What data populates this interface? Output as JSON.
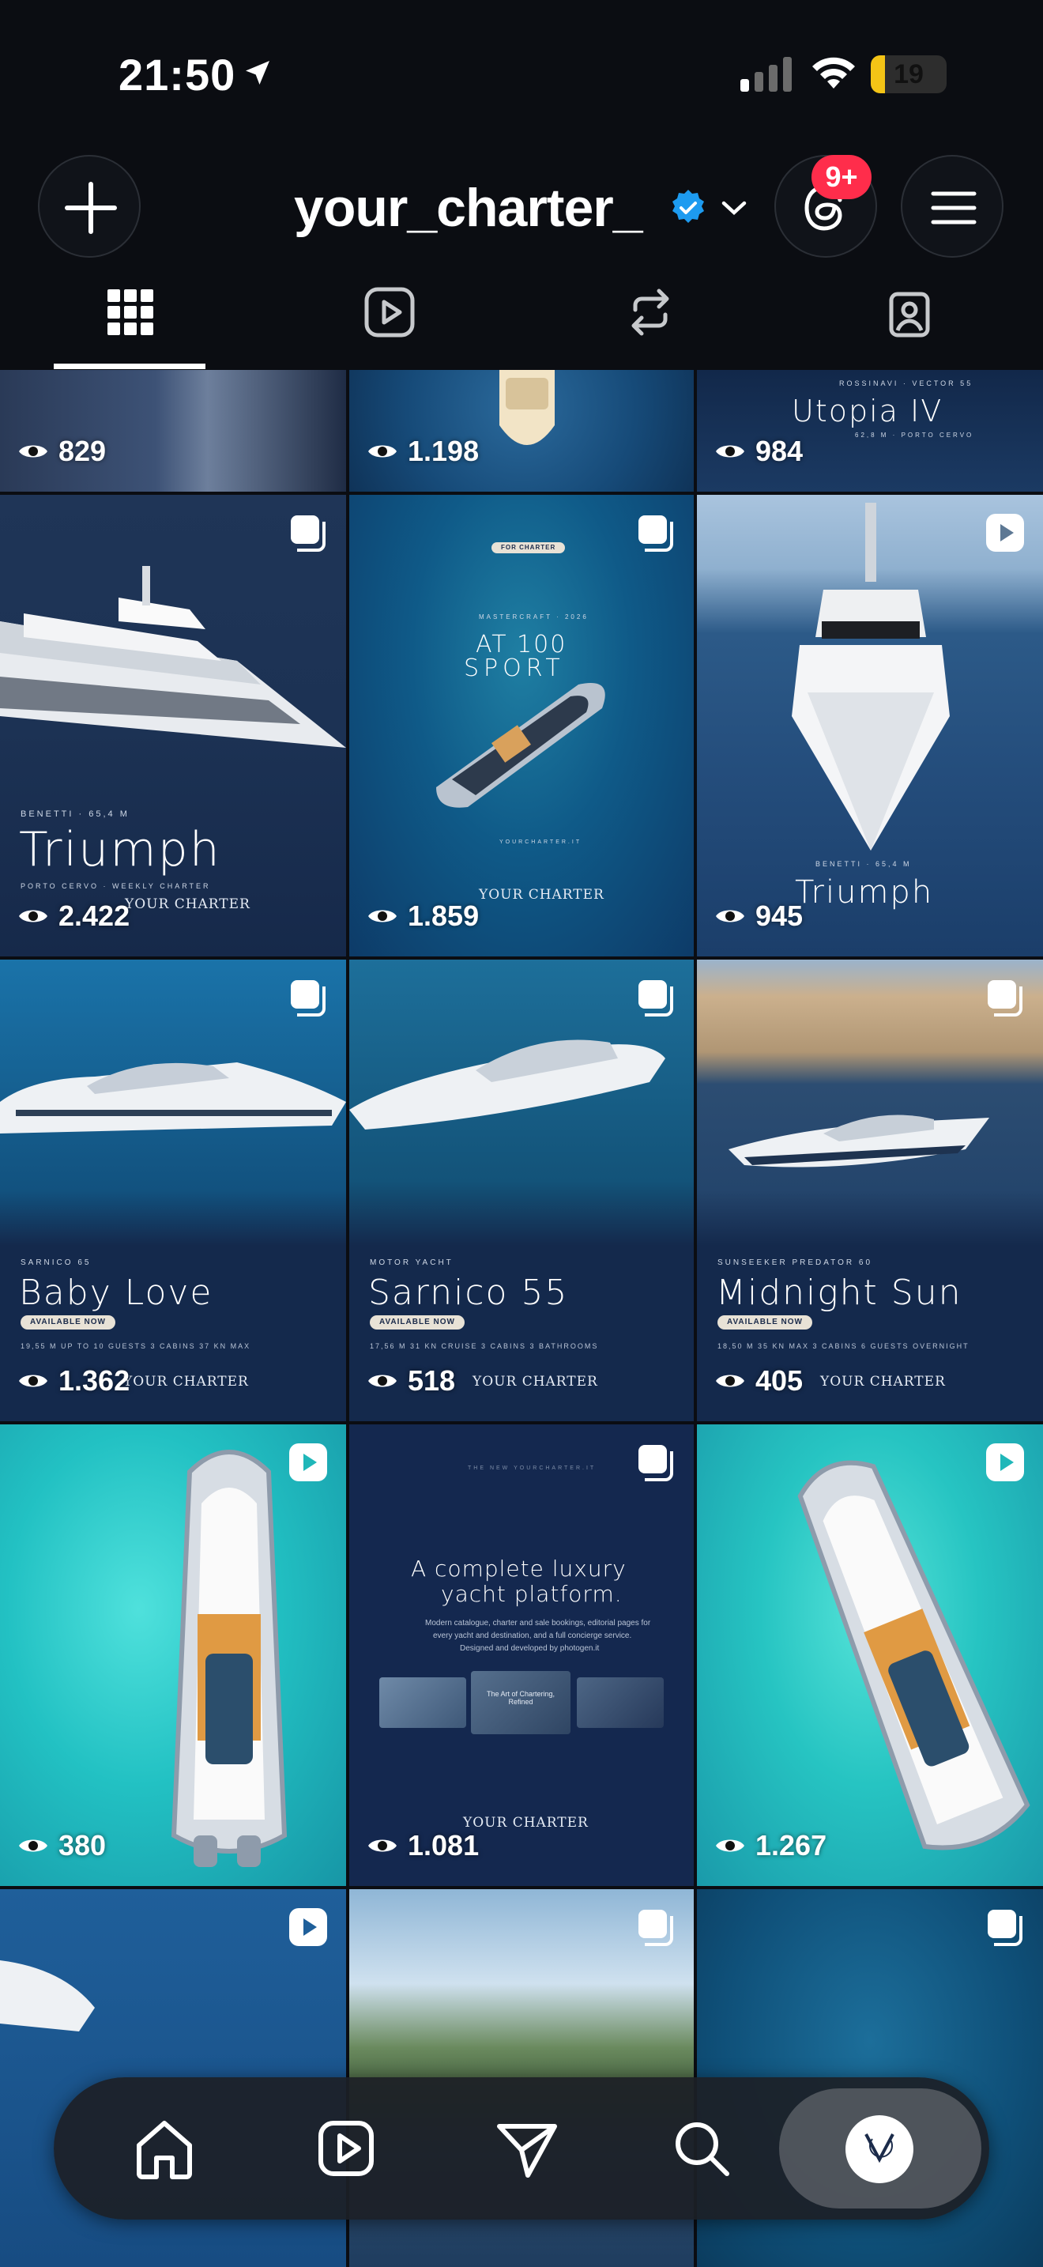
{
  "status_bar": {
    "time": "21:50",
    "battery": "19",
    "battery_level": 0.19,
    "battery_color": "#f4c416"
  },
  "header": {
    "username": "your_charter_",
    "notification_badge": "9+",
    "verified_color": "#1d9bf0"
  },
  "tabs": [
    {
      "icon": "grid-icon",
      "active": true
    },
    {
      "icon": "reels-icon",
      "active": false
    },
    {
      "icon": "reposts-icon",
      "active": false
    },
    {
      "icon": "tagged-icon",
      "active": false
    }
  ],
  "posts": [
    {
      "views": "829",
      "type": "none"
    },
    {
      "views": "1.198",
      "type": "none"
    },
    {
      "views": "984",
      "type": "none",
      "title": "Utopia IV",
      "subtitle": "ROSSINAVI · VECTOR 55",
      "caption": "62,8 M · PORTO CERVO"
    },
    {
      "views": "2.422",
      "type": "carousel",
      "title": "Triumph",
      "subtitle": "BENETTI · 65,4 M",
      "caption": "PORTO CERVO · WEEKLY CHARTER",
      "brand": "YOUR CHARTER"
    },
    {
      "views": "1.859",
      "type": "carousel",
      "pill": "FOR CHARTER",
      "title_line1": "AT 100",
      "title_line2": "SPORT",
      "subtitle": "MASTERCRAFT · 2026",
      "brand": "YOUR CHARTER",
      "footer": "YOURCHARTER.IT"
    },
    {
      "views": "945",
      "type": "reel",
      "title": "Triumph",
      "subtitle": "BENETTI · 65,4 M"
    },
    {
      "views": "1.362",
      "type": "carousel",
      "title": "Baby Love",
      "subtitle": "SARNICO 65",
      "pill": "AVAILABLE NOW",
      "specs": "19,55 M    UP TO 10 GUESTS    3 CABINS    37 KN MAX",
      "brand": "YOUR CHARTER"
    },
    {
      "views": "518",
      "type": "carousel",
      "title": "Sarnico 55",
      "subtitle": "MOTOR YACHT",
      "pill": "AVAILABLE NOW",
      "specs": "17,56 M    31 KN CRUISE    3 CABINS    3 BATHROOMS",
      "brand": "YOUR CHARTER"
    },
    {
      "views": "405",
      "type": "carousel",
      "title": "Midnight Sun",
      "subtitle": "SUNSEEKER PREDATOR 60",
      "pill": "AVAILABLE NOW",
      "specs": "18,50 M    35 KN MAX    3 CABINS    6 GUESTS OVERNIGHT",
      "brand": "YOUR CHARTER"
    },
    {
      "views": "380",
      "type": "reel"
    },
    {
      "views": "1.081",
      "type": "carousel",
      "headline_line1": "A complete luxury",
      "headline_line2": "yacht platform.",
      "kicker": "THE NEW YOURCHARTER.IT",
      "body_line1": "Modern catalogue, charter and sale bookings, editorial pages for",
      "body_line2": "every yacht and destination, and a full concierge service.",
      "body_line3": "Designed and developed by photogen.it",
      "card_text": "The Art of Chartering, Refined",
      "brand": "YOUR CHARTER"
    },
    {
      "views": "1.267",
      "type": "reel"
    },
    {
      "views": "",
      "type": "reel"
    },
    {
      "views": "",
      "type": "carousel"
    },
    {
      "views": "",
      "type": "carousel"
    }
  ],
  "bottom_nav": [
    "home-icon",
    "reels-icon",
    "direct-icon",
    "search-icon",
    "profile-avatar"
  ]
}
